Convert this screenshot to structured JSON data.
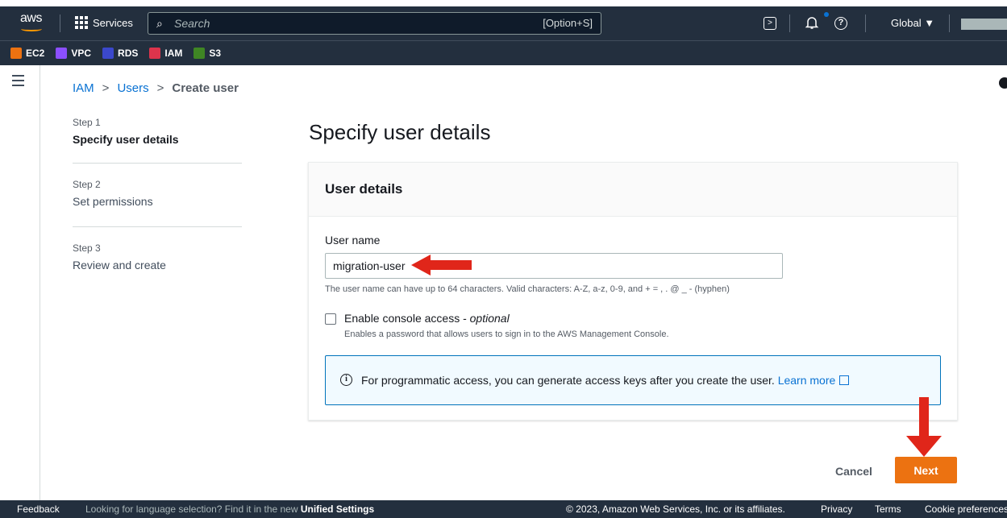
{
  "topnav": {
    "logo": "aws",
    "services_label": "Services",
    "search_placeholder": "Search",
    "search_shortcut": "[Option+S]",
    "region": "Global ▼"
  },
  "favorites": [
    {
      "label": "EC2",
      "color": "#ec7211"
    },
    {
      "label": "VPC",
      "color": "#8c4fff"
    },
    {
      "label": "RDS",
      "color": "#3b48cc"
    },
    {
      "label": "IAM",
      "color": "#dd344c"
    },
    {
      "label": "S3",
      "color": "#3f8624"
    }
  ],
  "breadcrumb": {
    "items": [
      "IAM",
      "Users"
    ],
    "current": "Create user"
  },
  "steps": [
    {
      "number": "Step 1",
      "title": "Specify user details"
    },
    {
      "number": "Step 2",
      "title": "Set permissions"
    },
    {
      "number": "Step 3",
      "title": "Review and create"
    }
  ],
  "page_title": "Specify user details",
  "panel": {
    "header": "User details",
    "username_label": "User name",
    "username_value": "migration-user",
    "username_hint": "The user name can have up to 64 characters. Valid characters: A-Z, a-z, 0-9, and + = , . @ _ - (hyphen)",
    "console_label": "Enable console access - ",
    "console_optional": "optional",
    "console_desc": "Enables a password that allows users to sign in to the AWS Management Console.",
    "info_text": "For programmatic access, you can generate access keys after you create the user. ",
    "info_link": "Learn more"
  },
  "actions": {
    "cancel": "Cancel",
    "next": "Next"
  },
  "footer": {
    "feedback": "Feedback",
    "language": "Looking for language selection? Find it in the new ",
    "unified": "Unified Settings",
    "copyright": "© 2023, Amazon Web Services, Inc. or its affiliates.",
    "privacy": "Privacy",
    "terms": "Terms",
    "cookie": "Cookie preferences"
  },
  "colors": {
    "primary_button": "#ec7211",
    "link": "#0972d3",
    "nav_bg": "#232f3e",
    "annotation_arrow": "#e0261a"
  }
}
